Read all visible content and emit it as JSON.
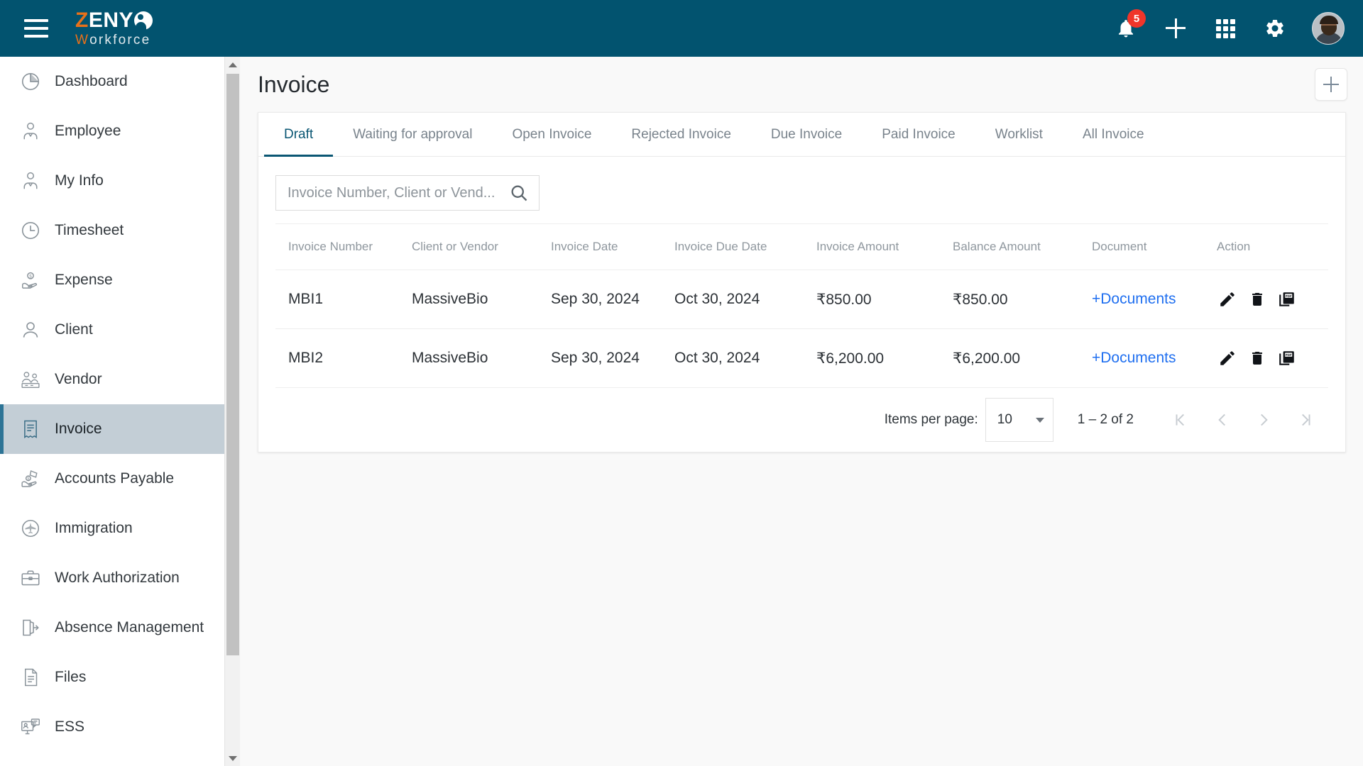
{
  "topbar": {
    "menu_icon": "hamburger-menu-icon",
    "logo": {
      "part1": "Z",
      "part2": "ENY",
      "part3": "W",
      "part4": "orkforce"
    },
    "notifications": {
      "icon": "bell-icon",
      "count": "5"
    },
    "add_icon": "plus-icon",
    "apps_icon": "grid-apps-icon",
    "settings_icon": "gear-icon",
    "avatar": "user-avatar",
    "bg_color": "#02536f"
  },
  "sidebar": {
    "items": [
      {
        "label": "Dashboard",
        "icon": "pie-chart-icon",
        "active": false
      },
      {
        "label": "Employee",
        "icon": "employee-icon",
        "active": false
      },
      {
        "label": "My Info",
        "icon": "my-info-icon",
        "active": false
      },
      {
        "label": "Timesheet",
        "icon": "clock-icon",
        "active": false
      },
      {
        "label": "Expense",
        "icon": "expense-hand-icon",
        "active": false
      },
      {
        "label": "Client",
        "icon": "person-icon",
        "active": false
      },
      {
        "label": "Vendor",
        "icon": "vendor-icon",
        "active": false
      },
      {
        "label": "Invoice",
        "icon": "invoice-icon",
        "active": true
      },
      {
        "label": "Accounts Payable",
        "icon": "accounts-payable-icon",
        "active": false
      },
      {
        "label": "Immigration",
        "icon": "airplane-icon",
        "active": false
      },
      {
        "label": "Work Authorization",
        "icon": "briefcase-icon",
        "active": false
      },
      {
        "label": "Absence Management",
        "icon": "exit-door-icon",
        "active": false
      },
      {
        "label": "Files",
        "icon": "document-icon",
        "active": false
      },
      {
        "label": "ESS",
        "icon": "ess-monitor-icon",
        "active": false
      }
    ],
    "active_bg": "#c3ced6",
    "active_border": "#2d7496"
  },
  "page": {
    "title": "Invoice",
    "add_button": "add-invoice-button"
  },
  "tabs": [
    {
      "label": "Draft",
      "active": true
    },
    {
      "label": "Waiting for approval",
      "active": false
    },
    {
      "label": "Open Invoice",
      "active": false
    },
    {
      "label": "Rejected Invoice",
      "active": false
    },
    {
      "label": "Due Invoice",
      "active": false
    },
    {
      "label": "Paid Invoice",
      "active": false
    },
    {
      "label": "Worklist",
      "active": false
    },
    {
      "label": "All Invoice",
      "active": false
    }
  ],
  "search": {
    "placeholder": "Invoice Number, Client or Vend...",
    "value": "",
    "icon": "search-icon"
  },
  "table": {
    "columns": [
      "Invoice Number",
      "Client or Vendor",
      "Invoice Date",
      "Invoice Due Date",
      "Invoice Amount",
      "Balance Amount",
      "Document",
      "Action"
    ],
    "rows": [
      {
        "invoice_number": "MBI1",
        "client_or_vendor": "MassiveBio",
        "invoice_date": "Sep 30, 2024",
        "invoice_due_date": "Oct 30, 2024",
        "invoice_amount": "₹850.00",
        "balance_amount": "₹850.00",
        "document": "+Documents",
        "actions": [
          "edit-pencil-icon",
          "delete-trash-icon",
          "pdf-icon"
        ]
      },
      {
        "invoice_number": "MBI2",
        "client_or_vendor": "MassiveBio",
        "invoice_date": "Sep 30, 2024",
        "invoice_due_date": "Oct 30, 2024",
        "invoice_amount": "₹6,200.00",
        "balance_amount": "₹6,200.00",
        "document": "+Documents",
        "actions": [
          "edit-pencil-icon",
          "delete-trash-icon",
          "pdf-icon"
        ]
      }
    ],
    "document_link_color": "#1f6ff0"
  },
  "paginator": {
    "items_per_page_label": "Items per page:",
    "items_per_page_value": "10",
    "range_label": "1 – 2 of 2",
    "first_page_icon": "first-page-icon",
    "prev_page_icon": "previous-page-icon",
    "next_page_icon": "next-page-icon",
    "last_page_icon": "last-page-icon"
  }
}
